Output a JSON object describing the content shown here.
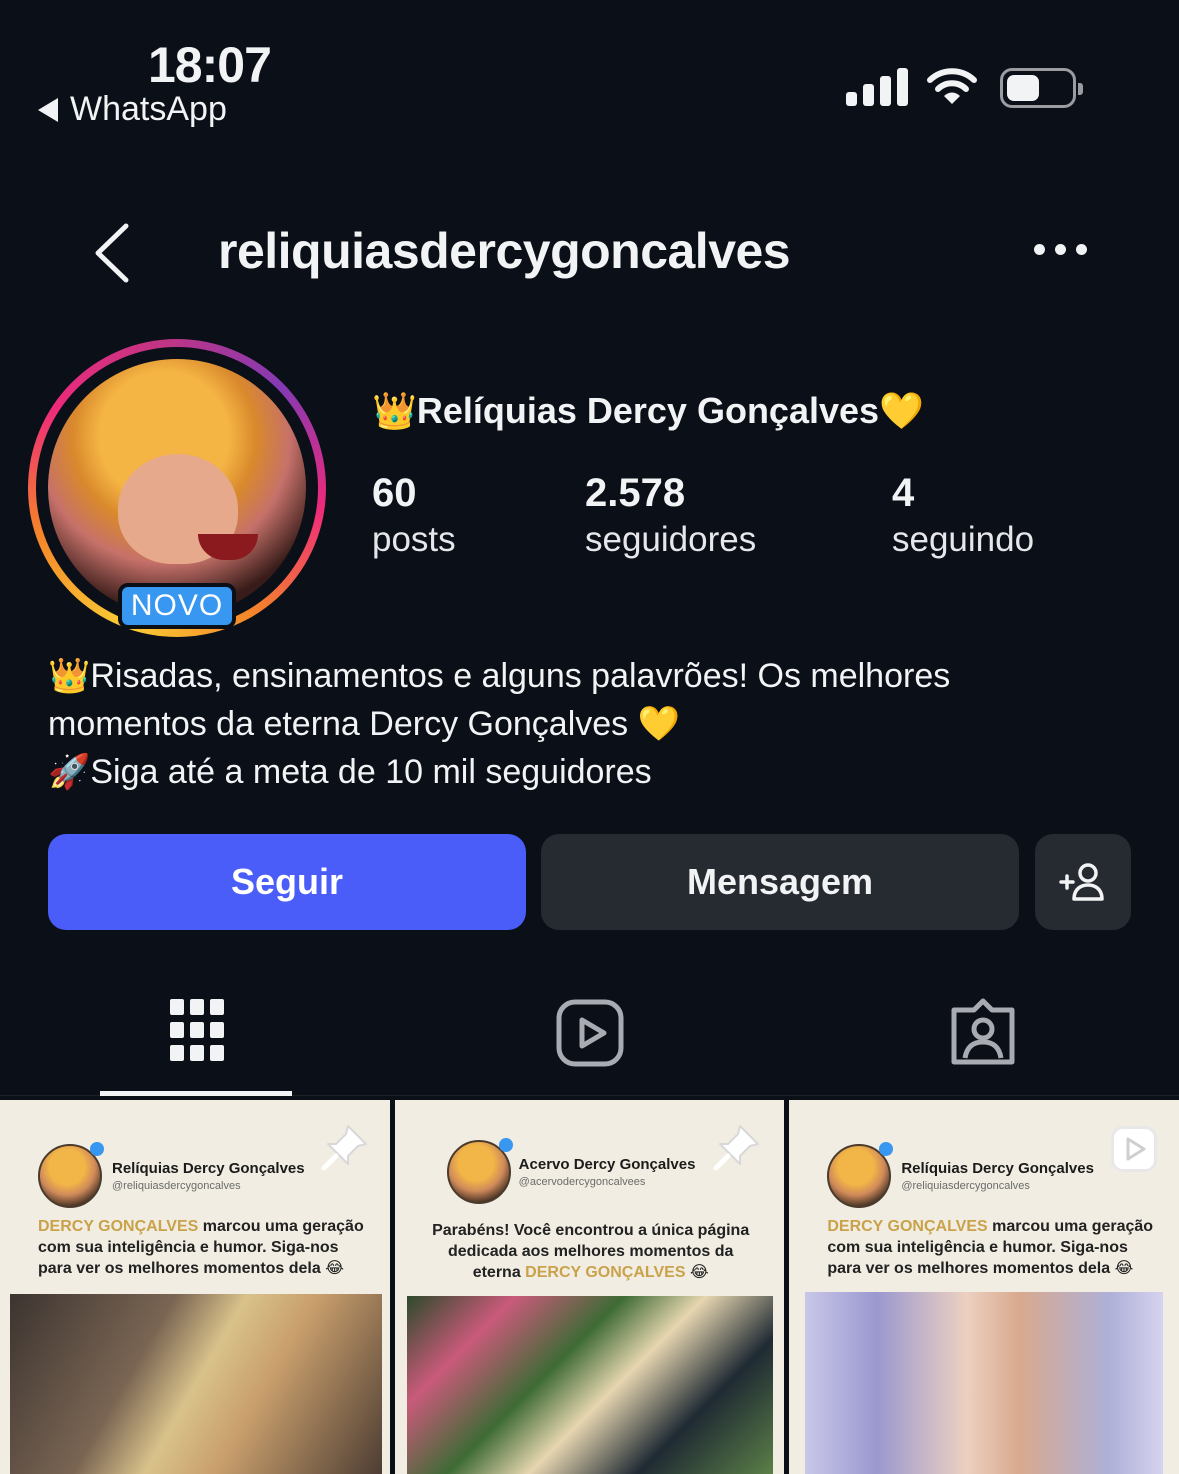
{
  "status_bar": {
    "time": "18:07",
    "back_app": "WhatsApp",
    "icons": [
      "signal-icon",
      "wifi-icon",
      "battery-icon"
    ]
  },
  "header": {
    "username": "reliquiasdercygoncalves",
    "back_icon": "chevron-left-icon",
    "more_icon": "more-horizontal-icon"
  },
  "profile": {
    "display_name": "👑Relíquias Dercy Gonçalves💛",
    "badge": "NOVO",
    "stats": [
      {
        "value": "60",
        "label": "posts"
      },
      {
        "value": "2.578",
        "label": "seguidores"
      },
      {
        "value": "4",
        "label": "seguindo"
      }
    ],
    "bio_lines": [
      "👑Risadas, ensinamentos e alguns palavrões! Os melhores",
      "momentos da eterna Dercy Gonçalves 💛",
      "🚀Siga até a meta de 10 mil seguidores"
    ]
  },
  "actions": {
    "follow": "Seguir",
    "message": "Mensagem",
    "add_user_icon": "add-person-icon"
  },
  "tabs": [
    {
      "icon": "grid-icon",
      "active": true
    },
    {
      "icon": "reels-icon",
      "active": false
    },
    {
      "icon": "tagged-icon",
      "active": false
    }
  ],
  "posts": [
    {
      "name": "Relíquias Dercy Gonçalves",
      "handle": "@reliquiasdercygoncalves",
      "text_highlight": "DERCY GONÇALVES",
      "text_rest": " marcou uma geração com sua inteligência e humor. Siga-nos para ver os melhores momentos dela 😂",
      "corner_icon": "pin-icon"
    },
    {
      "name": "Acervo Dercy Gonçalves",
      "handle": "@acervodercygoncalvees",
      "text_lead": "Parabéns! Você encontrou a única página dedicada aos melhores momentos da eterna ",
      "text_highlight": "DERCY GONÇALVES",
      "text_tail": " 😂",
      "corner_icon": "pin-icon"
    },
    {
      "name": "Relíquias Dercy Gonçalves",
      "handle": "@reliquiasdercygoncalves",
      "text_highlight": "DERCY GONÇALVES",
      "text_rest": " marcou uma geração com sua inteligência e humor. Siga-nos para ver os melhores momentos dela 😂",
      "corner_icon": "reel-icon"
    }
  ]
}
